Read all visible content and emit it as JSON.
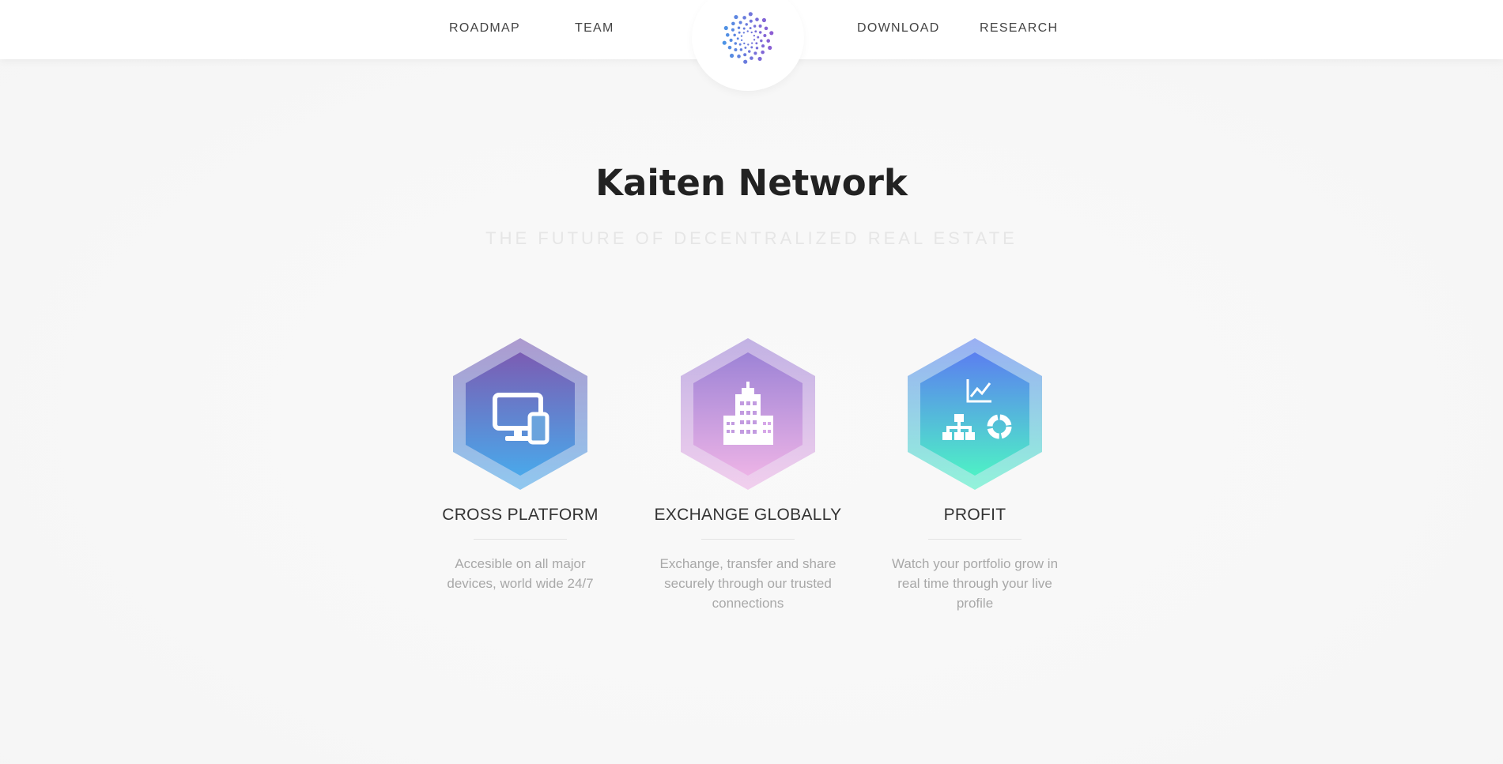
{
  "nav": {
    "items": [
      {
        "label": "ROADMAP"
      },
      {
        "label": "TEAM"
      },
      {
        "label": "DOWNLOAD"
      },
      {
        "label": "RESEARCH"
      }
    ],
    "logo_icon": "spiral-dots-logo"
  },
  "hero": {
    "title": "Kaiten Network",
    "subtitle": "THE FUTURE OF DECENTRALIZED REAL ESTATE"
  },
  "features": [
    {
      "title": "CROSS PLATFORM",
      "description": "Accesible on all major devices, world wide 24/7",
      "icon": "devices-icon",
      "gradient": [
        "#7b5cb3",
        "#4aa8ea"
      ]
    },
    {
      "title": "EXCHANGE GLOBALLY",
      "description": "Exchange, transfer and share securely through our trusted connections",
      "icon": "building-icon",
      "gradient": [
        "#9d83d6",
        "#ecb3e6"
      ]
    },
    {
      "title": "PROFIT",
      "description": "Watch your portfolio grow in real time through your live profile",
      "icon": "analytics-icon",
      "gradient": [
        "#5b7ff0",
        "#4ef0c6"
      ]
    }
  ],
  "colors": {
    "background": "#f8f8f8",
    "title": "#222222",
    "subtitle": "#e6e6e6",
    "description": "#a8a8a8"
  }
}
